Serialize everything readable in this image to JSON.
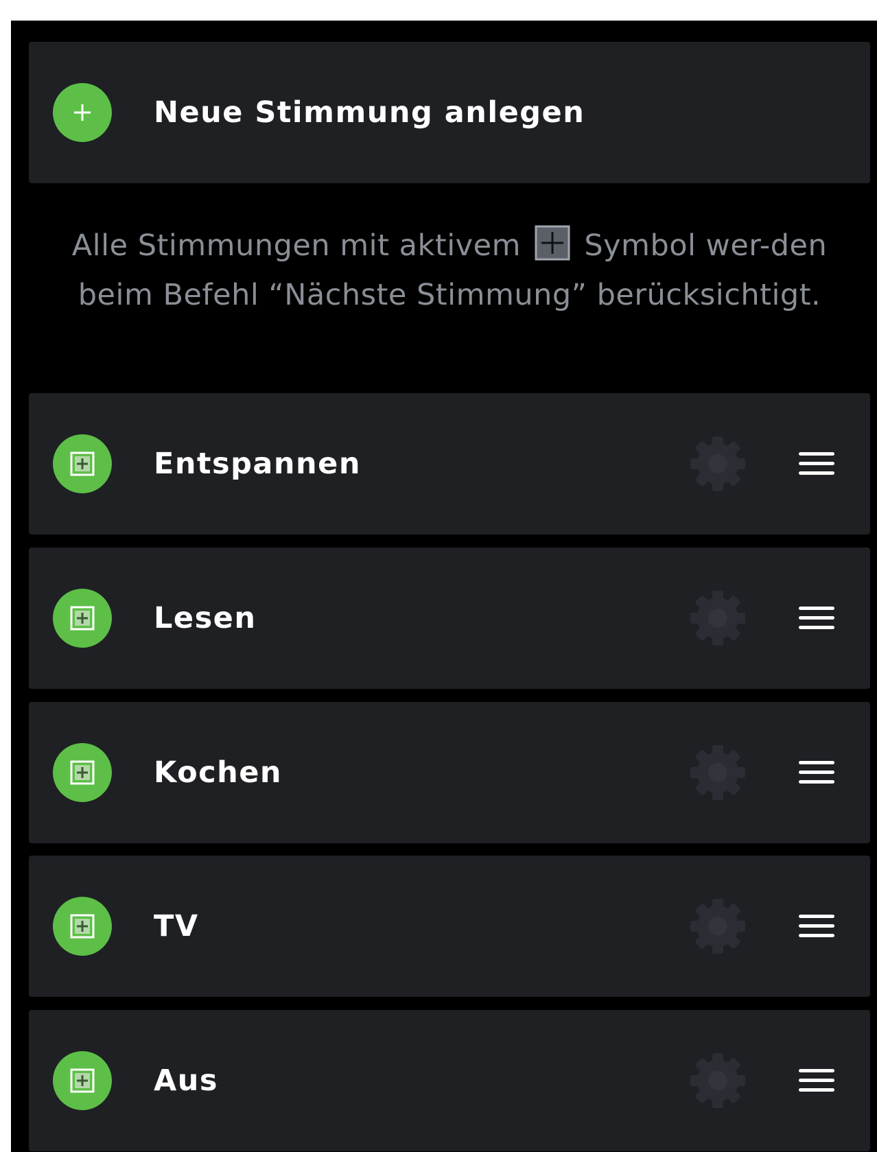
{
  "new_mood": {
    "label": "Neue Stimmung anlegen",
    "icon": "plus-icon"
  },
  "info": {
    "text_before": "Alle Stimmungen mit aktivem",
    "text_after": "Symbol wer-den beim Befehl “Nächste Stimmung” berücksichtigt.",
    "icon": "plus-square-icon"
  },
  "moods": [
    {
      "label": "Entspannen"
    },
    {
      "label": "Lesen"
    },
    {
      "label": "Kochen"
    },
    {
      "label": "TV"
    },
    {
      "label": "Aus"
    }
  ],
  "colors": {
    "accent_green": "#5dbf47",
    "card_background": "#1e2024",
    "screen_background": "#000000",
    "info_text": "#8a8f97"
  }
}
